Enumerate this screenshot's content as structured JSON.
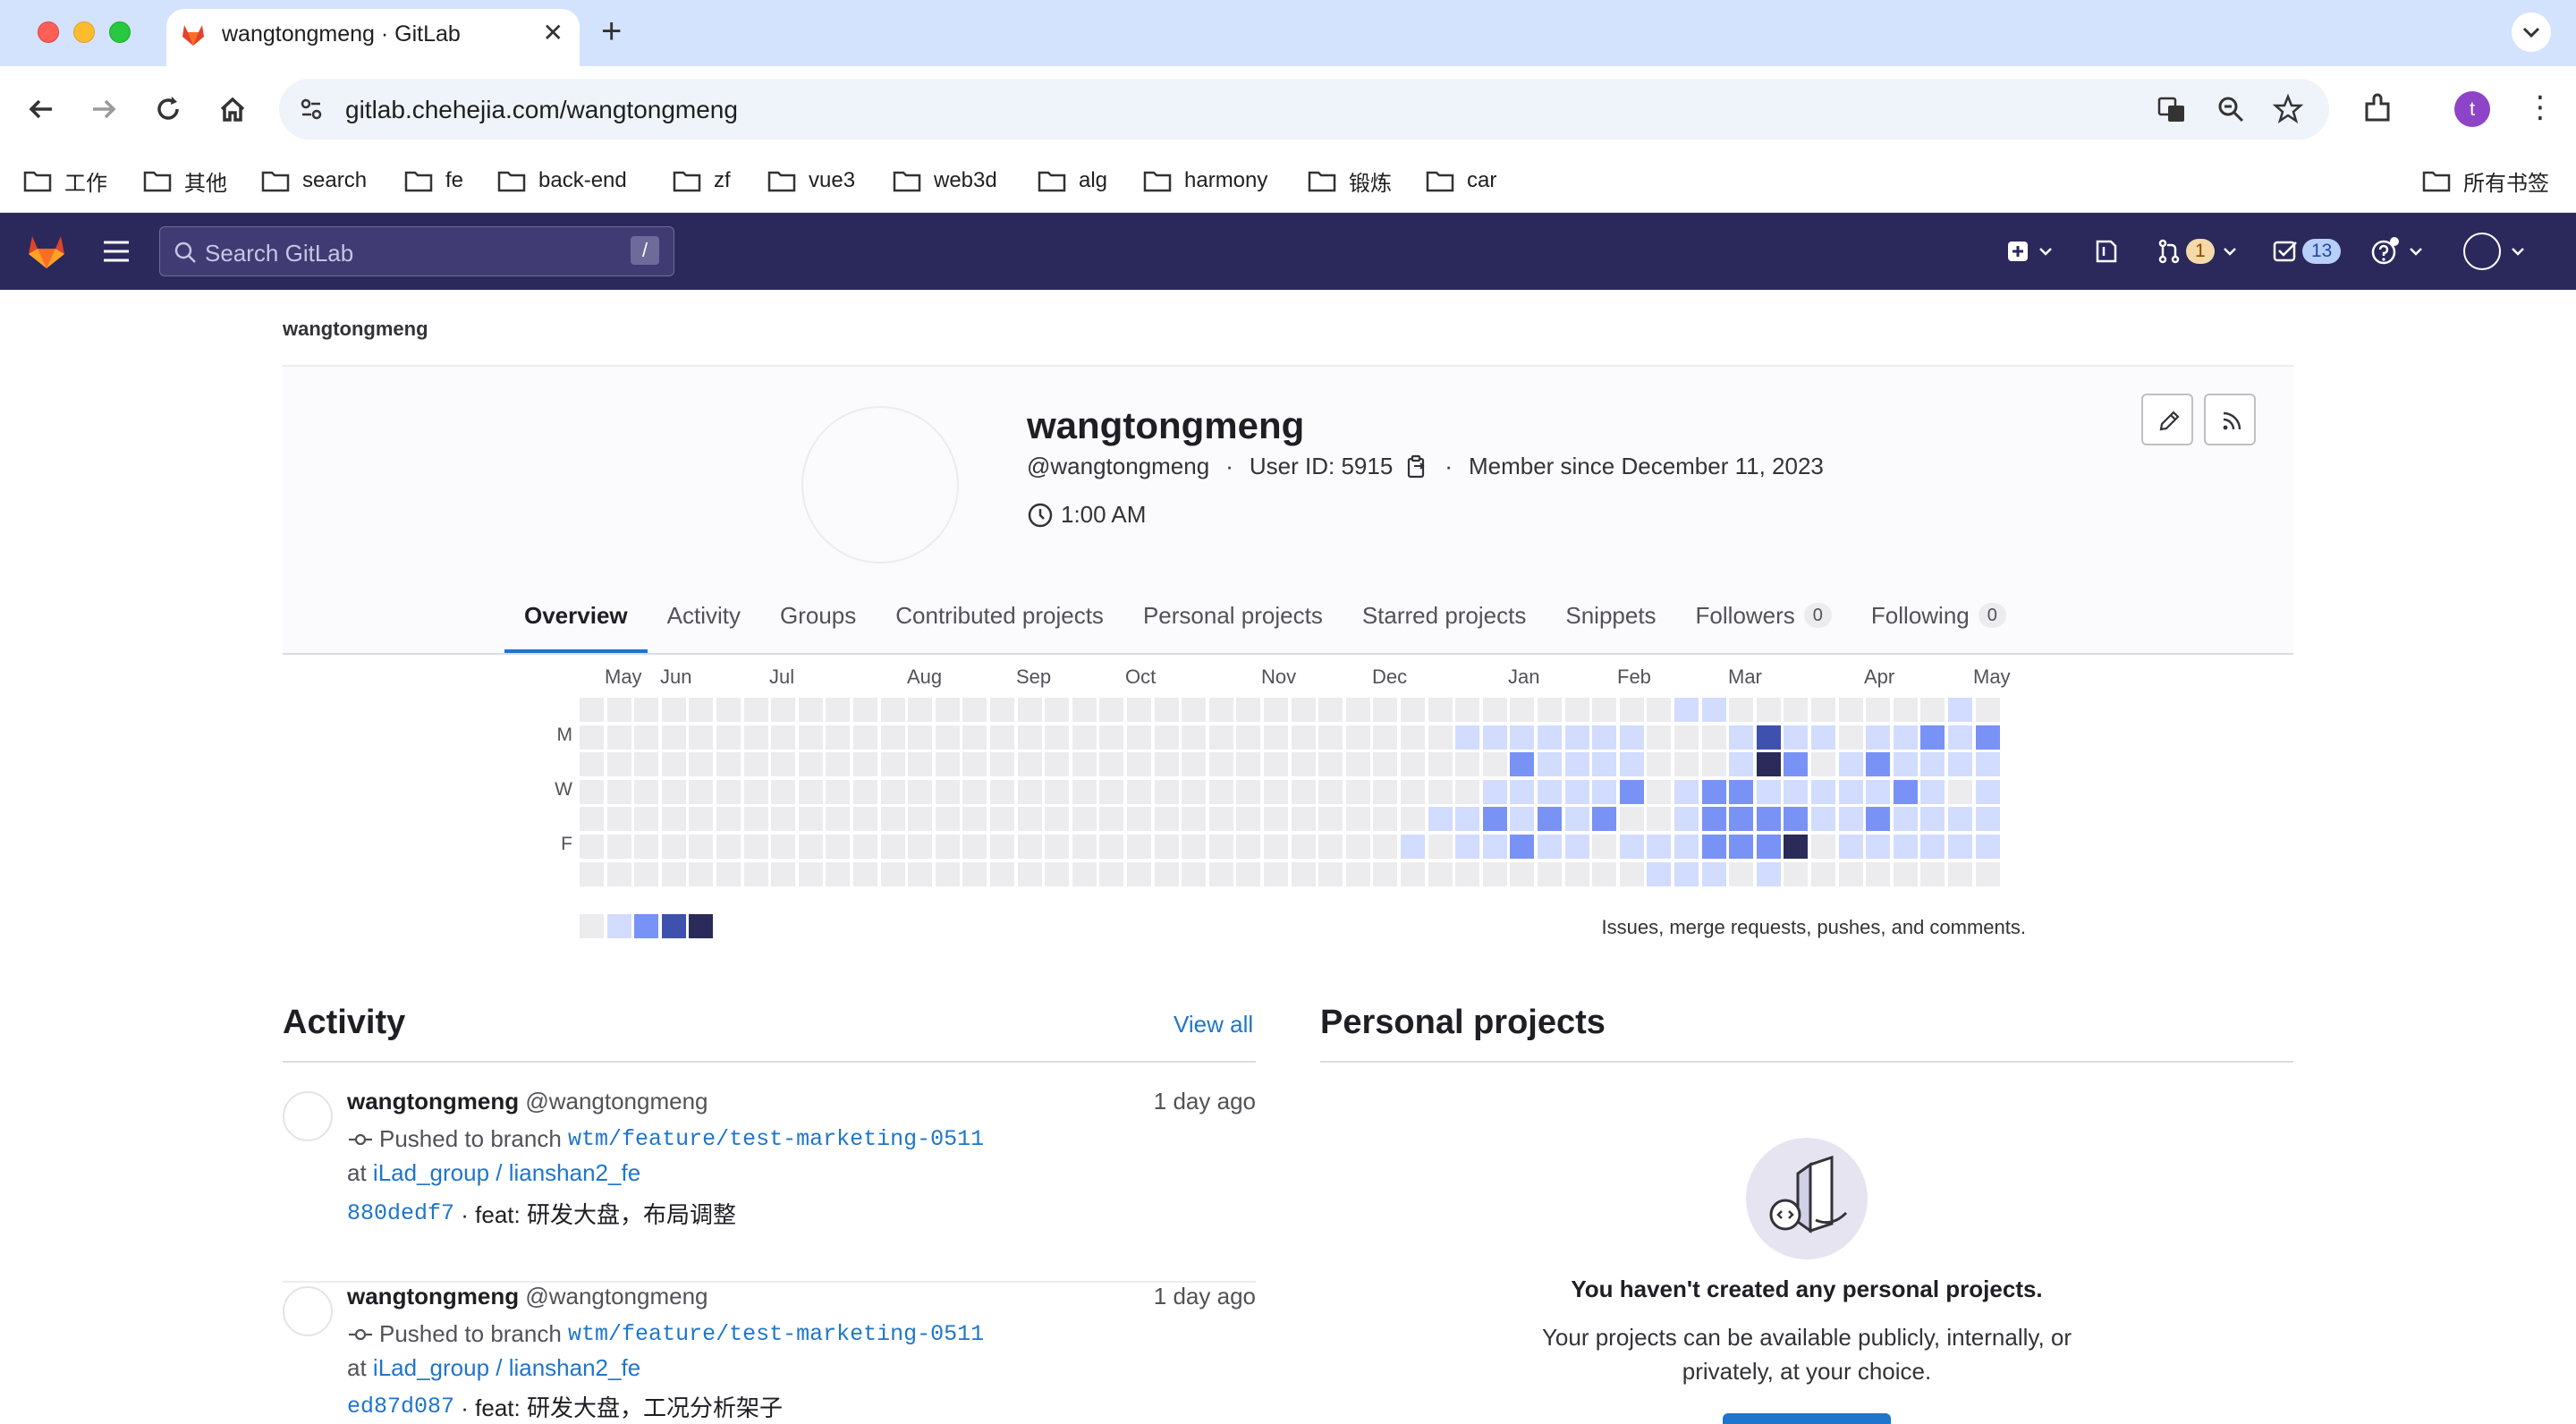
{
  "browser": {
    "tab_title": "wangtongmeng · GitLab",
    "url": "gitlab.chehejia.com/wangtongmeng",
    "profile_initial": "t",
    "bookmarks": [
      "工作",
      "其他",
      "search",
      "fe",
      "back-end",
      "zf",
      "vue3",
      "web3d",
      "alg",
      "harmony",
      "锻炼",
      "car"
    ],
    "all_bookmarks": "所有书签"
  },
  "gitlab_header": {
    "search_placeholder": "Search GitLab",
    "search_shortcut": "/",
    "merge_requests_count": "1",
    "todos_count": "13"
  },
  "breadcrumb": "wangtongmeng",
  "profile": {
    "name": "wangtongmeng",
    "username": "@wangtongmeng",
    "user_id": "User ID: 5915",
    "member_since": "Member since December 11, 2023",
    "local_time": "1:00 AM"
  },
  "tabs": [
    {
      "label": "Overview",
      "active": true
    },
    {
      "label": "Activity"
    },
    {
      "label": "Groups"
    },
    {
      "label": "Contributed projects"
    },
    {
      "label": "Personal projects"
    },
    {
      "label": "Starred projects"
    },
    {
      "label": "Snippets"
    },
    {
      "label": "Followers",
      "count": "0"
    },
    {
      "label": "Following",
      "count": "0"
    }
  ],
  "calendar": {
    "months": [
      "May",
      "Jun",
      "Jul",
      "Aug",
      "Sep",
      "Oct",
      "Nov",
      "Dec",
      "Jan",
      "Feb",
      "Mar",
      "Apr",
      "May"
    ],
    "day_labels": [
      "M",
      "W",
      "F"
    ],
    "caption": "Issues, merge requests, pushes, and comments.",
    "level_colors": [
      "#ececef",
      "#d2dcff",
      "#7992f5",
      "#3f51ae",
      "#2a2b59"
    ],
    "weeks": 52,
    "levels_by_week": [
      [
        0,
        0,
        0,
        0,
        0,
        0,
        0
      ],
      [
        0,
        0,
        0,
        0,
        0,
        0,
        0
      ],
      [
        0,
        0,
        0,
        0,
        0,
        0,
        0
      ],
      [
        0,
        0,
        0,
        0,
        0,
        0,
        0
      ],
      [
        0,
        0,
        0,
        0,
        0,
        0,
        0
      ],
      [
        0,
        0,
        0,
        0,
        0,
        0,
        0
      ],
      [
        0,
        0,
        0,
        0,
        0,
        0,
        0
      ],
      [
        0,
        0,
        0,
        0,
        0,
        0,
        0
      ],
      [
        0,
        0,
        0,
        0,
        0,
        0,
        0
      ],
      [
        0,
        0,
        0,
        0,
        0,
        0,
        0
      ],
      [
        0,
        0,
        0,
        0,
        0,
        0,
        0
      ],
      [
        0,
        0,
        0,
        0,
        0,
        0,
        0
      ],
      [
        0,
        0,
        0,
        0,
        0,
        0,
        0
      ],
      [
        0,
        0,
        0,
        0,
        0,
        0,
        0
      ],
      [
        0,
        0,
        0,
        0,
        0,
        0,
        0
      ],
      [
        0,
        0,
        0,
        0,
        0,
        0,
        0
      ],
      [
        0,
        0,
        0,
        0,
        0,
        0,
        0
      ],
      [
        0,
        0,
        0,
        0,
        0,
        0,
        0
      ],
      [
        0,
        0,
        0,
        0,
        0,
        0,
        0
      ],
      [
        0,
        0,
        0,
        0,
        0,
        0,
        0
      ],
      [
        0,
        0,
        0,
        0,
        0,
        0,
        0
      ],
      [
        0,
        0,
        0,
        0,
        0,
        0,
        0
      ],
      [
        0,
        0,
        0,
        0,
        0,
        0,
        0
      ],
      [
        0,
        0,
        0,
        0,
        0,
        0,
        0
      ],
      [
        0,
        0,
        0,
        0,
        0,
        0,
        0
      ],
      [
        0,
        0,
        0,
        0,
        0,
        0,
        0
      ],
      [
        0,
        0,
        0,
        0,
        0,
        0,
        0
      ],
      [
        0,
        0,
        0,
        0,
        0,
        0,
        0
      ],
      [
        0,
        0,
        0,
        0,
        0,
        0,
        0
      ],
      [
        0,
        0,
        0,
        0,
        0,
        0,
        0
      ],
      [
        0,
        0,
        0,
        0,
        0,
        1,
        0
      ],
      [
        0,
        0,
        0,
        0,
        1,
        0,
        0
      ],
      [
        0,
        1,
        0,
        0,
        1,
        1,
        0
      ],
      [
        0,
        1,
        0,
        1,
        2,
        1,
        0
      ],
      [
        0,
        1,
        2,
        1,
        1,
        2,
        0
      ],
      [
        0,
        1,
        1,
        1,
        2,
        1,
        0
      ],
      [
        0,
        1,
        1,
        1,
        1,
        1,
        0
      ],
      [
        0,
        1,
        1,
        1,
        2,
        0,
        0
      ],
      [
        0,
        1,
        1,
        2,
        0,
        1,
        0
      ],
      [
        0,
        0,
        0,
        0,
        0,
        1,
        1
      ],
      [
        1,
        0,
        0,
        1,
        1,
        1,
        1
      ],
      [
        1,
        0,
        0,
        2,
        2,
        2,
        1
      ],
      [
        0,
        1,
        1,
        2,
        2,
        2,
        0
      ],
      [
        0,
        3,
        4,
        1,
        2,
        2,
        1
      ],
      [
        0,
        1,
        2,
        1,
        2,
        4,
        0
      ],
      [
        0,
        1,
        0,
        1,
        1,
        0,
        0
      ],
      [
        0,
        0,
        1,
        1,
        1,
        1,
        0
      ],
      [
        0,
        1,
        2,
        1,
        2,
        1,
        0
      ],
      [
        0,
        1,
        1,
        2,
        1,
        1,
        0
      ],
      [
        0,
        2,
        1,
        1,
        1,
        1,
        0
      ],
      [
        1,
        1,
        1,
        0,
        1,
        1,
        0
      ],
      [
        0,
        2,
        1,
        1,
        1,
        1,
        0
      ]
    ]
  },
  "activity": {
    "title": "Activity",
    "view_all": "View all",
    "events": [
      {
        "author": "wangtongmeng",
        "handle": "@wangtongmeng",
        "time": "1 day ago",
        "action": "Pushed to branch",
        "branch": "wtm/feature/test-marketing-0511",
        "at": "at",
        "project": "iLad_group / lianshan2_fe",
        "commit": "880dedf7",
        "message": "· feat: 研发大盘，布局调整"
      },
      {
        "author": "wangtongmeng",
        "handle": "@wangtongmeng",
        "time": "1 day ago",
        "action": "Pushed to branch",
        "branch": "wtm/feature/test-marketing-0511",
        "at": "at",
        "project": "iLad_group / lianshan2_fe",
        "commit": "ed87d087",
        "message": "· feat: 研发大盘，工况分析架子"
      }
    ]
  },
  "personal_projects": {
    "title": "Personal projects",
    "empty_title": "You haven't created any personal projects.",
    "empty_description": "Your projects can be available publicly, internally, or privately, at your choice."
  }
}
